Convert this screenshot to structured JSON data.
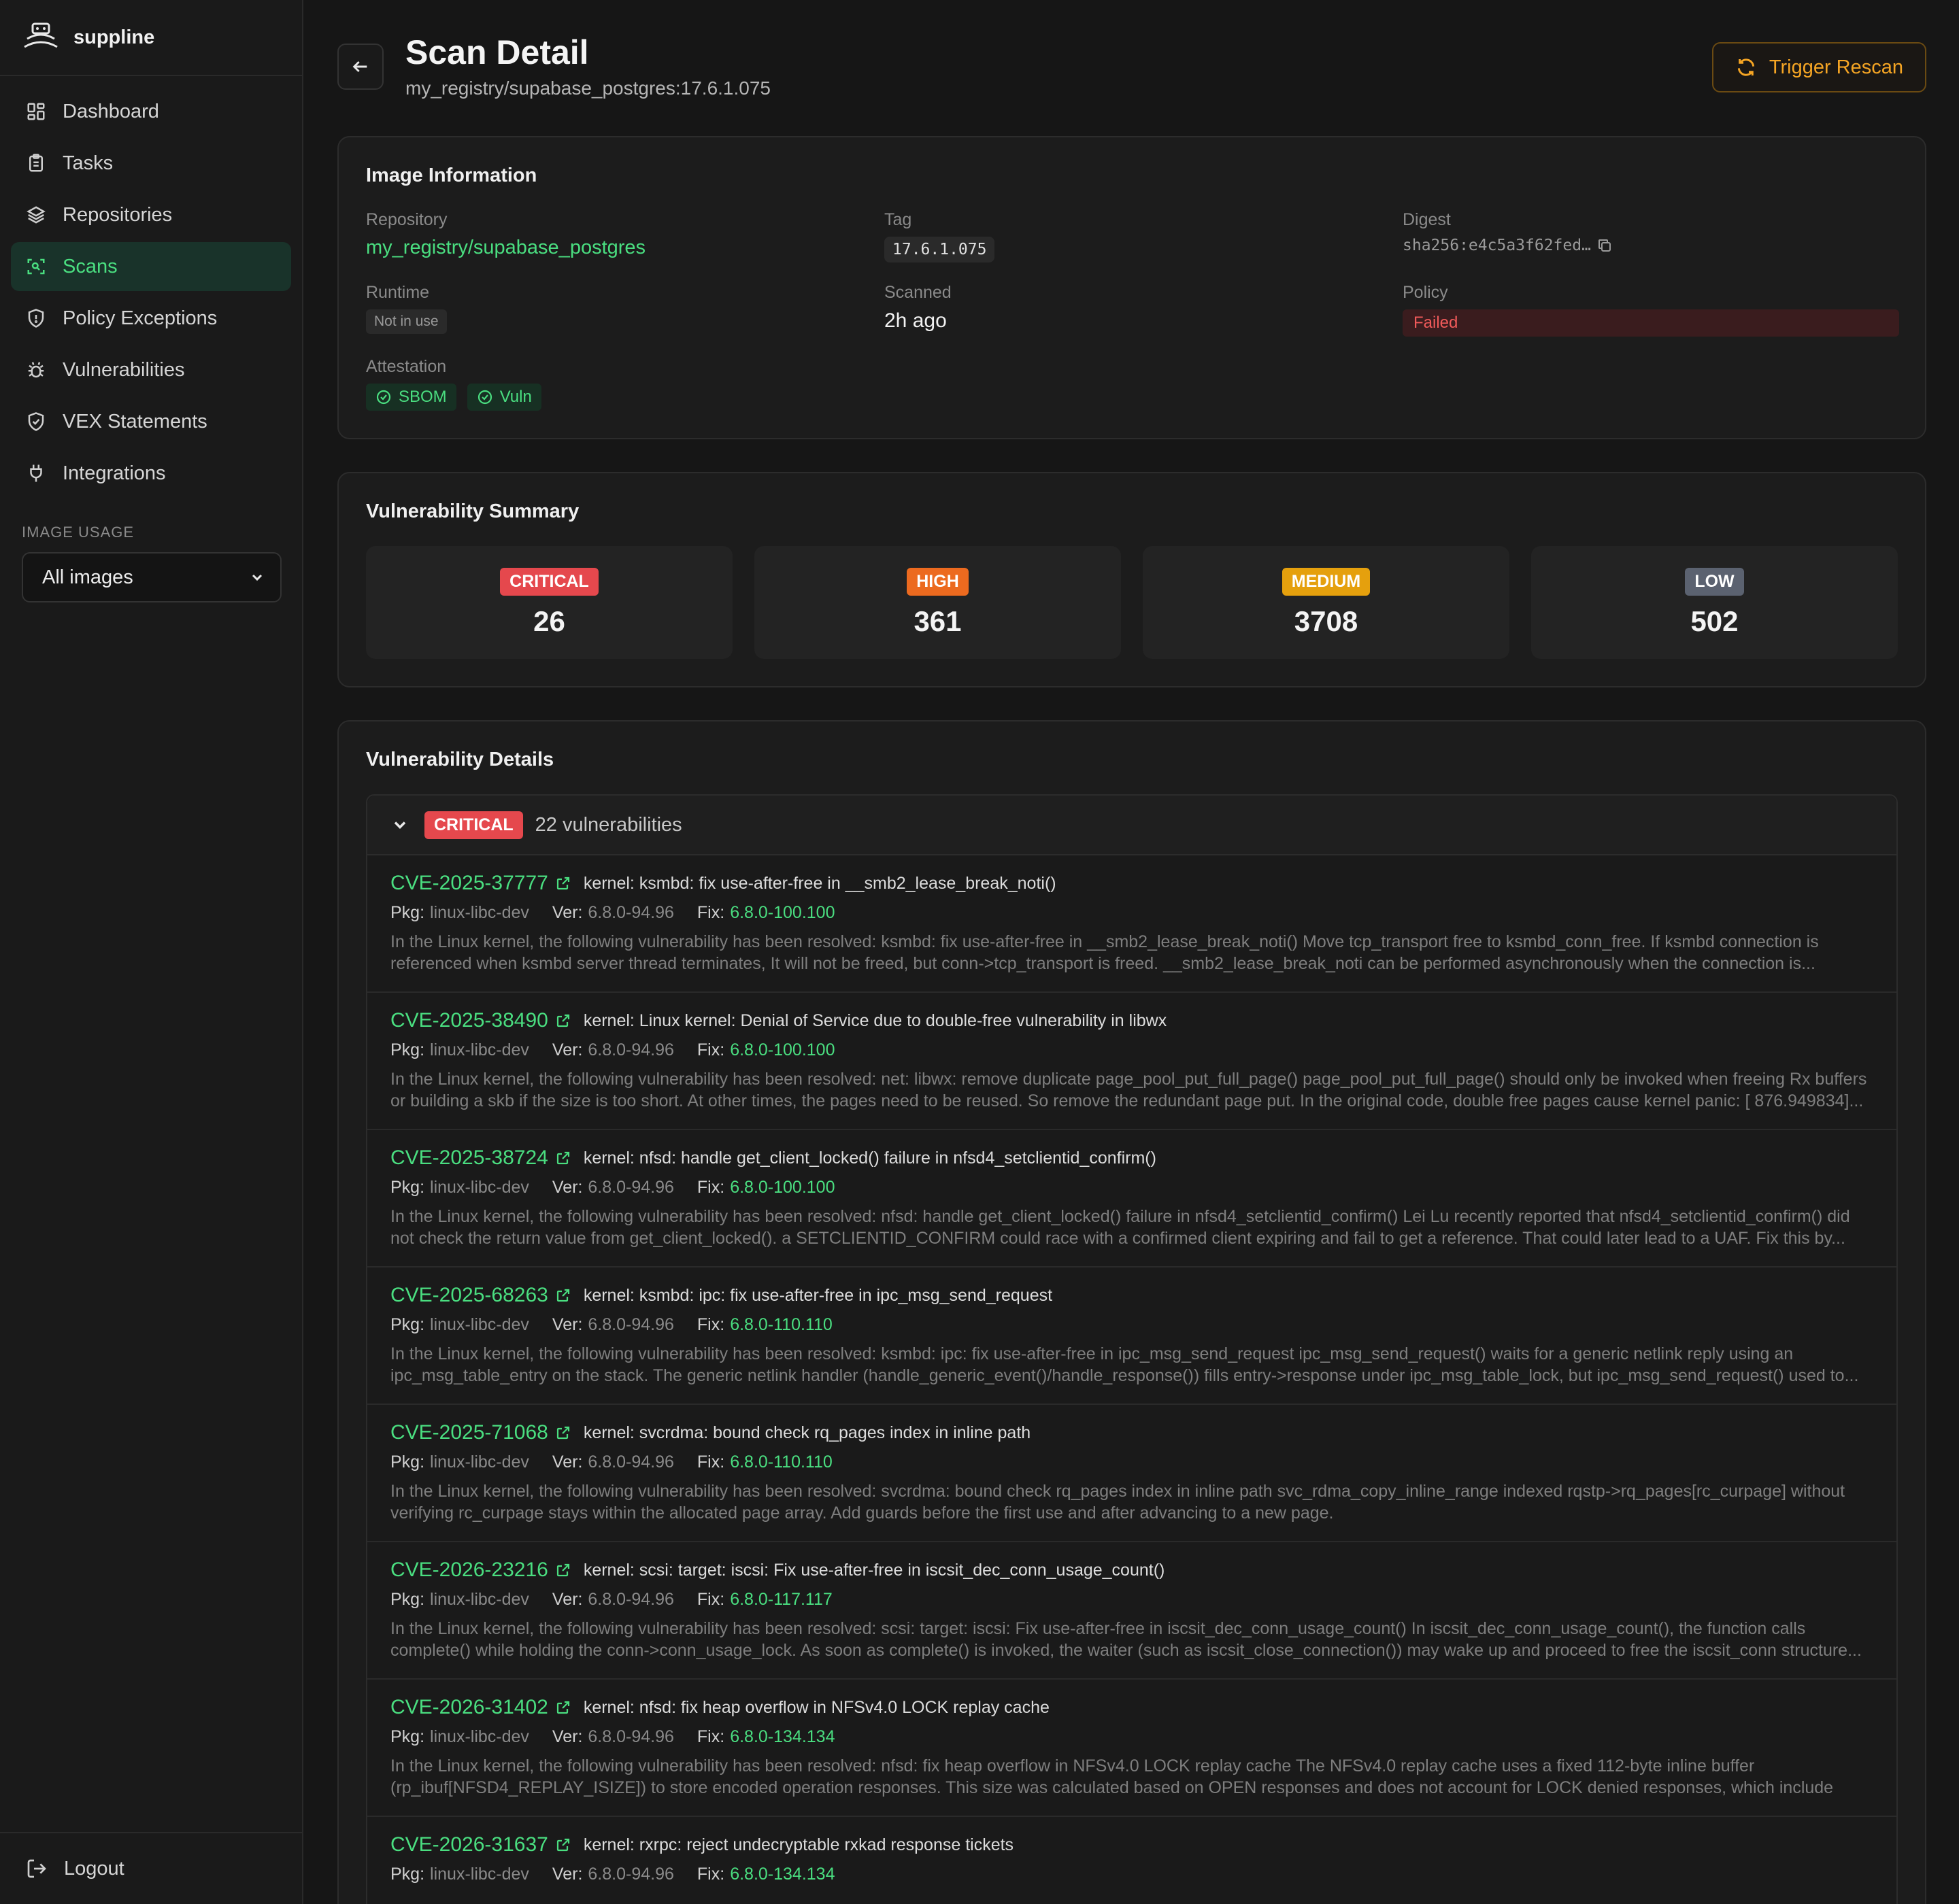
{
  "app": {
    "name": "suppline"
  },
  "sidebar": {
    "items": [
      {
        "label": "Dashboard",
        "icon": "dashboard-icon"
      },
      {
        "label": "Tasks",
        "icon": "clipboard-icon"
      },
      {
        "label": "Repositories",
        "icon": "layers-icon"
      },
      {
        "label": "Scans",
        "icon": "scan-icon",
        "active": true
      },
      {
        "label": "Policy Exceptions",
        "icon": "shield-alert-icon"
      },
      {
        "label": "Vulnerabilities",
        "icon": "bug-icon"
      },
      {
        "label": "VEX Statements",
        "icon": "shield-check-icon"
      },
      {
        "label": "Integrations",
        "icon": "plug-icon"
      }
    ],
    "image_usage_label": "IMAGE USAGE",
    "image_usage_value": "All images",
    "logout_label": "Logout"
  },
  "header": {
    "title": "Scan Detail",
    "subtitle": "my_registry/supabase_postgres:17.6.1.075",
    "rescan_label": "Trigger Rescan"
  },
  "image_info": {
    "title": "Image Information",
    "repository_label": "Repository",
    "repository": "my_registry/supabase_postgres",
    "tag_label": "Tag",
    "tag": "17.6.1.075",
    "digest_label": "Digest",
    "digest": "sha256:e4c5a3f62fed…",
    "runtime_label": "Runtime",
    "runtime": "Not in use",
    "scanned_label": "Scanned",
    "scanned": "2h ago",
    "policy_label": "Policy",
    "policy": "Failed",
    "attestation_label": "Attestation",
    "attestations": [
      "SBOM",
      "Vuln"
    ]
  },
  "summary": {
    "title": "Vulnerability Summary",
    "items": [
      {
        "severity": "CRITICAL",
        "count": "26",
        "color": "#e5484d"
      },
      {
        "severity": "HIGH",
        "count": "361",
        "color": "#ec6a1f"
      },
      {
        "severity": "MEDIUM",
        "count": "3708",
        "color": "#e5a00d"
      },
      {
        "severity": "LOW",
        "count": "502",
        "color": "#5b6270"
      }
    ]
  },
  "details": {
    "title": "Vulnerability Details",
    "group_severity": "CRITICAL",
    "group_count": "22 vulnerabilities",
    "pkg_label": "Pkg:",
    "ver_label": "Ver:",
    "fix_label": "Fix:",
    "vulns": [
      {
        "id": "CVE-2025-37777",
        "title": "kernel: ksmbd: fix use-after-free in __smb2_lease_break_noti()",
        "pkg": "linux-libc-dev",
        "ver": "6.8.0-94.96",
        "fix": "6.8.0-100.100",
        "desc": "In the Linux kernel, the following vulnerability has been resolved: ksmbd: fix use-after-free in __smb2_lease_break_noti() Move tcp_transport free to ksmbd_conn_free. If ksmbd connection is referenced when ksmbd server thread terminates, It will not be freed, but conn->tcp_transport is freed. __smb2_lease_break_noti can be performed asynchronously when the connection is..."
      },
      {
        "id": "CVE-2025-38490",
        "title": "kernel: Linux kernel: Denial of Service due to double-free vulnerability in libwx",
        "pkg": "linux-libc-dev",
        "ver": "6.8.0-94.96",
        "fix": "6.8.0-100.100",
        "desc": "In the Linux kernel, the following vulnerability has been resolved: net: libwx: remove duplicate page_pool_put_full_page() page_pool_put_full_page() should only be invoked when freeing Rx buffers or building a skb if the size is too short. At other times, the pages need to be reused. So remove the redundant page put. In the original code, double free pages cause kernel panic: [ 876.949834]..."
      },
      {
        "id": "CVE-2025-38724",
        "title": "kernel: nfsd: handle get_client_locked() failure in nfsd4_setclientid_confirm()",
        "pkg": "linux-libc-dev",
        "ver": "6.8.0-94.96",
        "fix": "6.8.0-100.100",
        "desc": "In the Linux kernel, the following vulnerability has been resolved: nfsd: handle get_client_locked() failure in nfsd4_setclientid_confirm() Lei Lu recently reported that nfsd4_setclientid_confirm() did not check the return value from get_client_locked(). a SETCLIENTID_CONFIRM could race with a confirmed client expiring and fail to get a reference. That could later lead to a UAF. Fix this by..."
      },
      {
        "id": "CVE-2025-68263",
        "title": "kernel: ksmbd: ipc: fix use-after-free in ipc_msg_send_request",
        "pkg": "linux-libc-dev",
        "ver": "6.8.0-94.96",
        "fix": "6.8.0-110.110",
        "desc": "In the Linux kernel, the following vulnerability has been resolved: ksmbd: ipc: fix use-after-free in ipc_msg_send_request ipc_msg_send_request() waits for a generic netlink reply using an ipc_msg_table_entry on the stack. The generic netlink handler (handle_generic_event()/handle_response()) fills entry->response under ipc_msg_table_lock, but ipc_msg_send_request() used to..."
      },
      {
        "id": "CVE-2025-71068",
        "title": "kernel: svcrdma: bound check rq_pages index in inline path",
        "pkg": "linux-libc-dev",
        "ver": "6.8.0-94.96",
        "fix": "6.8.0-110.110",
        "desc": "In the Linux kernel, the following vulnerability has been resolved: svcrdma: bound check rq_pages index in inline path svc_rdma_copy_inline_range indexed rqstp->rq_pages[rc_curpage] without verifying rc_curpage stays within the allocated page array. Add guards before the first use and after advancing to a new page."
      },
      {
        "id": "CVE-2026-23216",
        "title": "kernel: scsi: target: iscsi: Fix use-after-free in iscsit_dec_conn_usage_count()",
        "pkg": "linux-libc-dev",
        "ver": "6.8.0-94.96",
        "fix": "6.8.0-117.117",
        "desc": "In the Linux kernel, the following vulnerability has been resolved: scsi: target: iscsi: Fix use-after-free in iscsit_dec_conn_usage_count() In iscsit_dec_conn_usage_count(), the function calls complete() while holding the conn->conn_usage_lock. As soon as complete() is invoked, the waiter (such as iscsit_close_connection()) may wake up and proceed to free the iscsit_conn structure..."
      },
      {
        "id": "CVE-2026-31402",
        "title": "kernel: nfsd: fix heap overflow in NFSv4.0 LOCK replay cache",
        "pkg": "linux-libc-dev",
        "ver": "6.8.0-94.96",
        "fix": "6.8.0-134.134",
        "desc": "In the Linux kernel, the following vulnerability has been resolved: nfsd: fix heap overflow in NFSv4.0 LOCK replay cache The NFSv4.0 replay cache uses a fixed 112-byte inline buffer (rp_ibuf[NFSD4_REPLAY_ISIZE]) to store encoded operation responses. This size was calculated based on OPEN responses and does not account for LOCK denied responses, which include the..."
      },
      {
        "id": "CVE-2026-31637",
        "title": "kernel: rxrpc: reject undecryptable rxkad response tickets",
        "pkg": "linux-libc-dev",
        "ver": "6.8.0-94.96",
        "fix": "6.8.0-134.134",
        "desc": ""
      }
    ]
  }
}
